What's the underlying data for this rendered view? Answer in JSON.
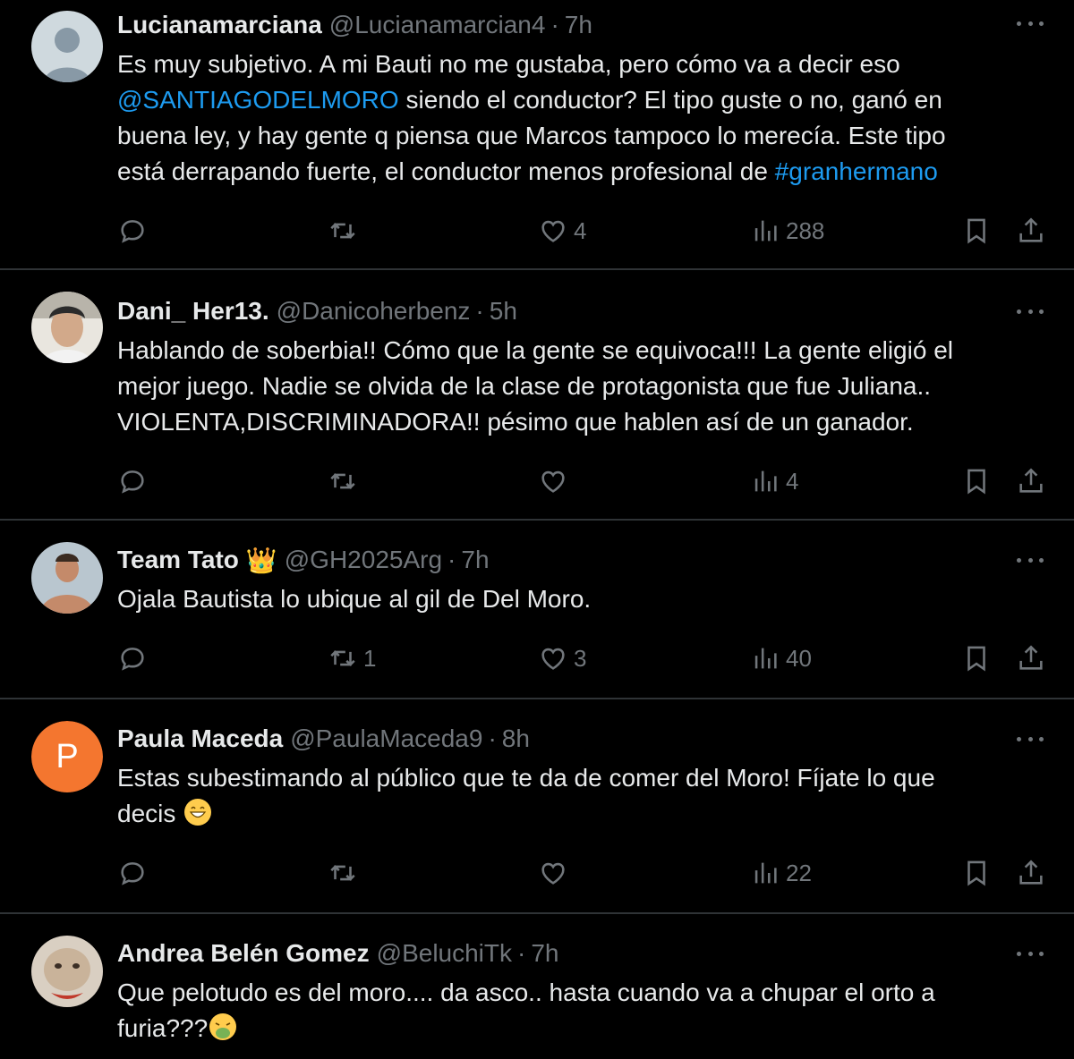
{
  "tweets": [
    {
      "name": "Lucianamarciana",
      "handle": "@Lucianamarcian4",
      "time": "7h",
      "text_lines": [
        "Es muy subjetivo. A mi Bauti no me gustaba, pero cómo va a decir eso",
        "siendo el conductor? El tipo guste o no, ganó en",
        "buena ley, y hay gente q piensa que Marcos tampoco lo merecía. Este tipo",
        "está derrapando fuerte, el conductor menos profesional de"
      ],
      "mention": "@SANTIAGODELMORO",
      "hashtag": "#granhermano",
      "replies": "",
      "retweets": "",
      "likes": "4",
      "views": "288"
    },
    {
      "name": "Dani_ Her13.",
      "handle": "@Danicoherbenz",
      "time": "5h",
      "text_lines": [
        "Hablando de soberbia!! Cómo que la gente se equivoca!!! La gente eligió el",
        "mejor juego. Nadie se olvida de la clase de protagonista que fue Juliana..",
        "VIOLENTA,DISCRIMINADORA!! pésimo que hablen así de un ganador."
      ],
      "replies": "",
      "retweets": "",
      "likes": "",
      "views": "4"
    },
    {
      "name": "Team Tato",
      "crown": "👑",
      "handle": "@GH2025Arg",
      "time": "7h",
      "text_lines": [
        "Ojala Bautista lo ubique al gil de Del Moro."
      ],
      "replies": "",
      "retweets": "1",
      "likes": "3",
      "views": "40"
    },
    {
      "name": "Paula Maceda",
      "handle": "@PaulaMaceda9",
      "time": "8h",
      "avatar_letter": "P",
      "text_lines": [
        "Estas subestimando al público que te da de comer del Moro! Fíjate lo que",
        "decis"
      ],
      "replies": "",
      "retweets": "",
      "likes": "",
      "views": "22"
    },
    {
      "name": "Andrea Belén Gomez",
      "handle": "@BeluchiTk",
      "time": "7h",
      "text_lines": [
        "Que pelotudo es del moro.... da asco.. hasta cuando va a chupar el orto a",
        "furia???"
      ]
    }
  ],
  "colors": {
    "background": "#000000",
    "text": "#e7e9ea",
    "muted": "#71767b",
    "link": "#1d9bf0",
    "divider": "#2f3336",
    "paula_avatar": "#f4762f"
  },
  "icons": [
    "reply-icon",
    "retweet-icon",
    "like-icon",
    "views-icon",
    "bookmark-icon",
    "share-icon",
    "more-icon",
    "crown-icon"
  ]
}
